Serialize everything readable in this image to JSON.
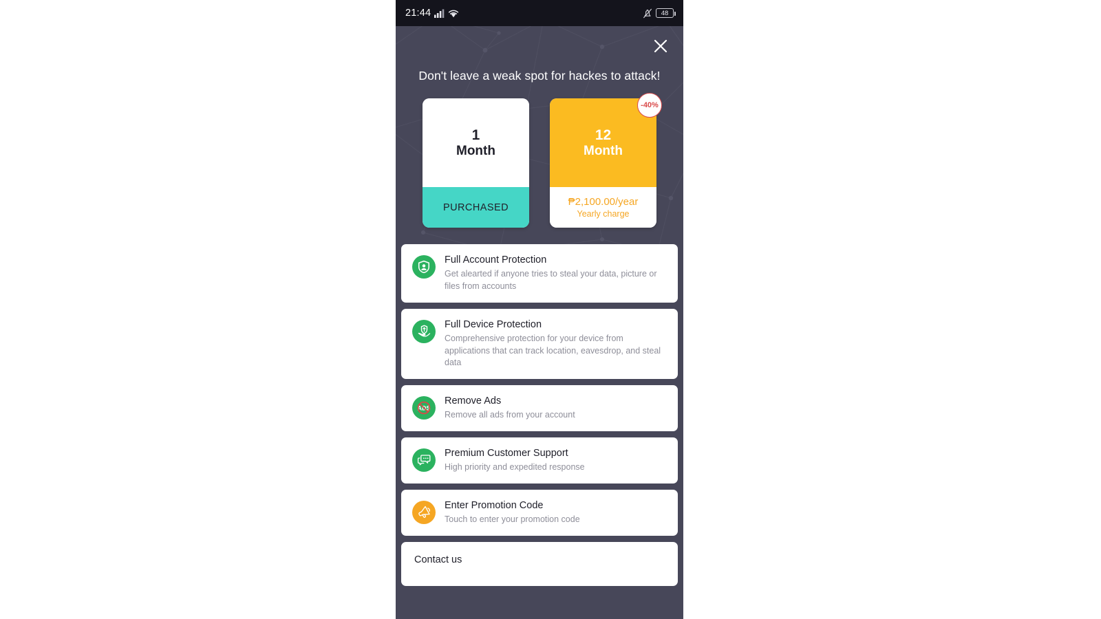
{
  "status_bar": {
    "clock": "21:44",
    "signal_icon": "cellular-signal-icon",
    "wifi_icon": "wifi-icon",
    "silent_icon": "silent-mode-icon",
    "battery_level": "48"
  },
  "hero": {
    "close_icon": "close-icon",
    "title": "Don't leave a weak spot for hackes to attack!",
    "background_color": "#474759"
  },
  "plans": [
    {
      "id": "monthly",
      "number": "1",
      "unit": "Month",
      "status": "PURCHASED",
      "top_color": "#ffffff",
      "bottom_color": "#45D6C6",
      "badge": null
    },
    {
      "id": "yearly",
      "number": "12",
      "unit": "Month",
      "price": "₱2,100.00/year",
      "price_sub": "Yearly charge",
      "top_color": "#FBBB21",
      "bottom_color": "#ffffff",
      "badge": "-40%",
      "badge_color": "#D94A4A"
    }
  ],
  "features": [
    {
      "icon": "shield-account-icon",
      "icon_color": "#2BB25F",
      "title": "Full Account Protection",
      "desc": "Get alearted if anyone tries to steal your data, picture or files from accounts"
    },
    {
      "icon": "hand-shield-icon",
      "icon_color": "#2BB25F",
      "title": "Full Device Protection",
      "desc": "Comprehensive protection for your device from applications that can track location, eavesdrop, and steal data"
    },
    {
      "icon": "no-ads-icon",
      "icon_color": "#2BB25F",
      "title": "Remove Ads",
      "desc": "Remove all ads from your account"
    },
    {
      "icon": "chat-support-icon",
      "icon_color": "#2BB25F",
      "title": "Premium Customer Support",
      "desc": "High priority and expedited response"
    },
    {
      "icon": "megaphone-icon",
      "icon_color": "#F5A623",
      "title": "Enter Promotion Code",
      "desc": "Touch to enter your promotion code"
    }
  ],
  "contact": {
    "label": "Contact us"
  }
}
